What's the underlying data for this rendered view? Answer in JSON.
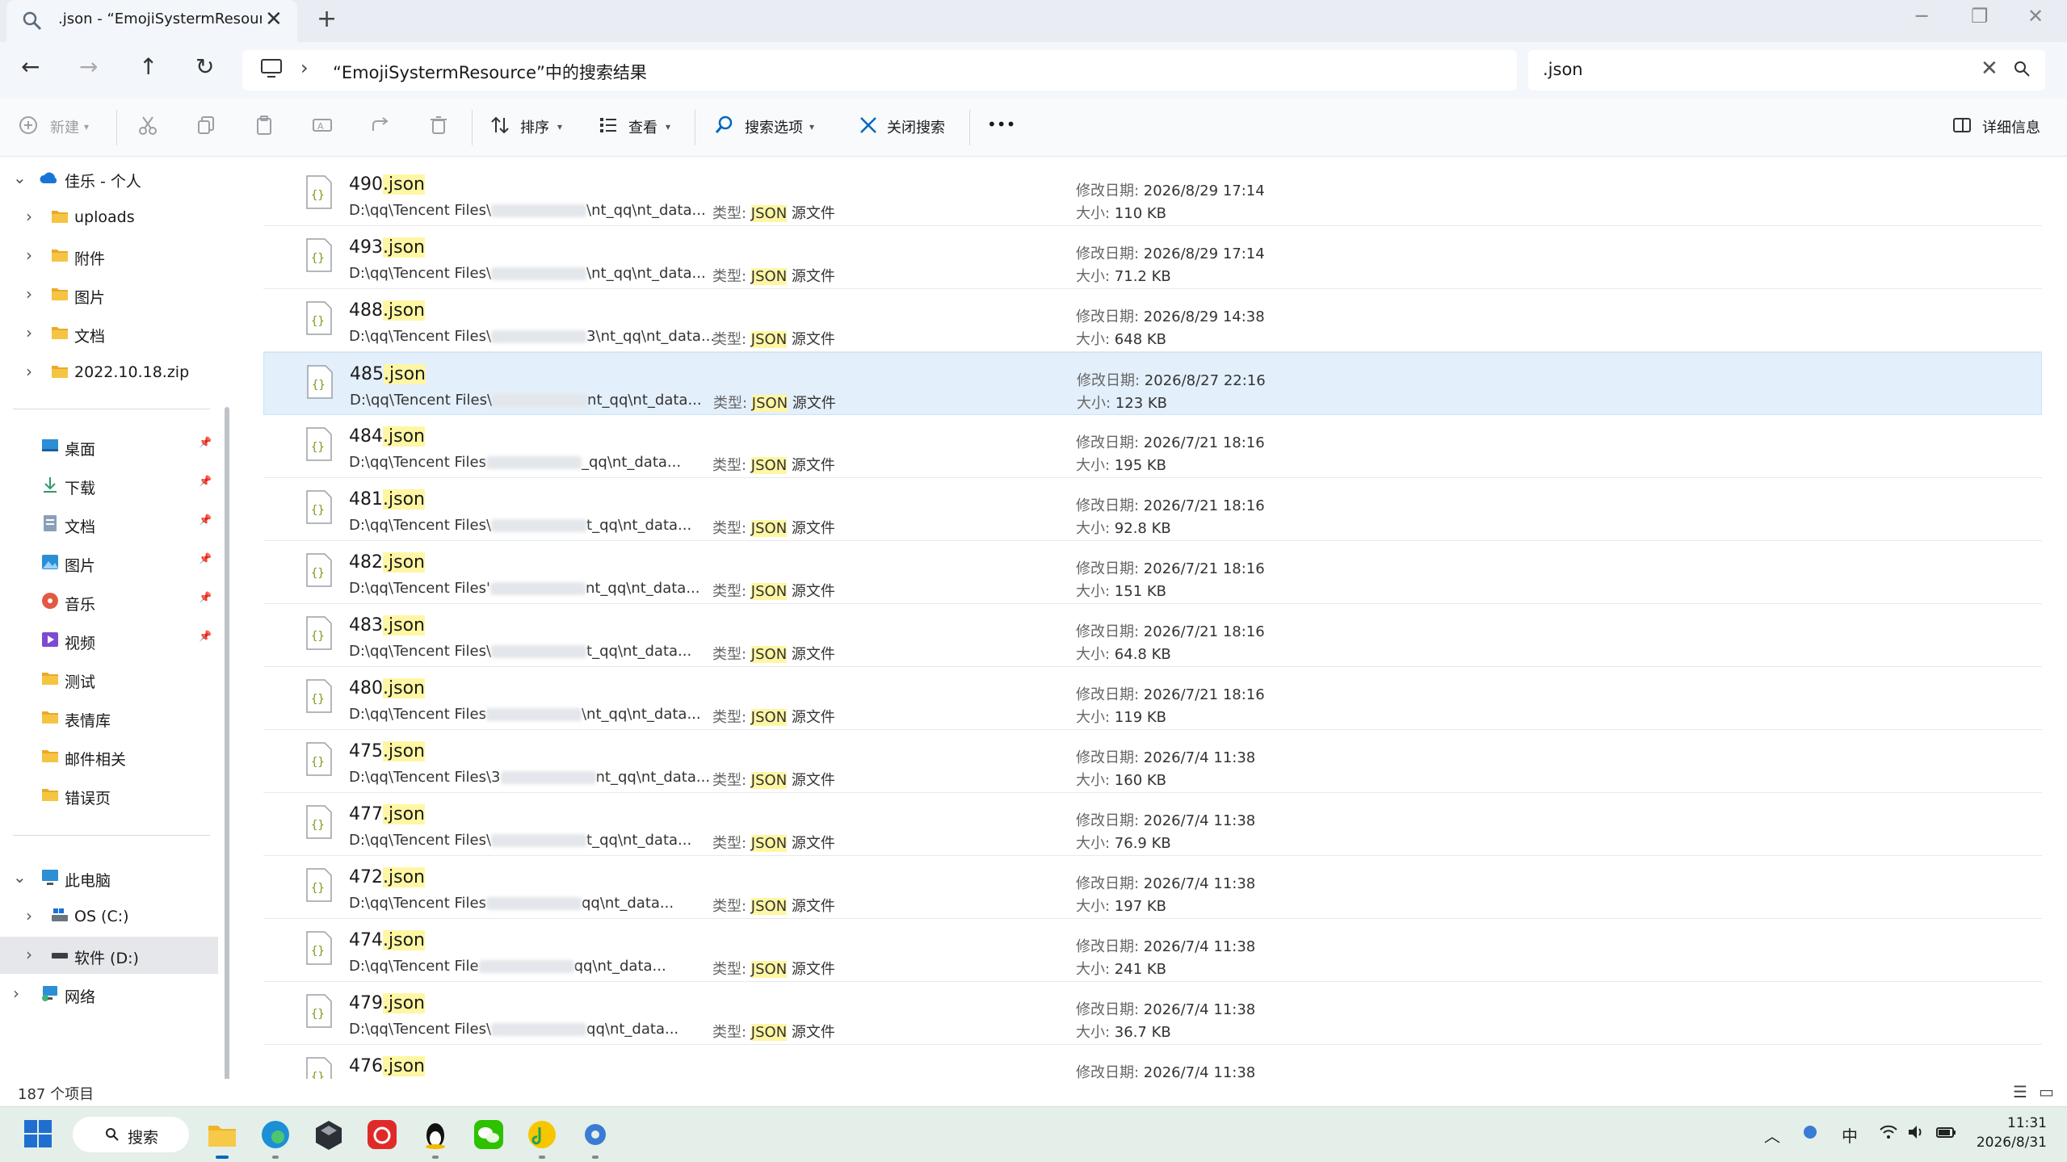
{
  "window": {
    "tab_title": ".json - “EmojiSystermResource",
    "tab_close": "✕",
    "new_tab": "+",
    "minimize": "─",
    "restore": "❐",
    "close": "✕"
  },
  "nav": {
    "back": "←",
    "forward": "→",
    "up": "↑",
    "refresh": "↻",
    "chevron": "›",
    "address": "“EmojiSystermResource”中的搜索结果",
    "search_value": ".json",
    "search_clear": "✕"
  },
  "toolbar": {
    "new": "新建",
    "sort": "排序",
    "view": "查看",
    "search_options": "搜索选项",
    "close_search": "关闭搜索",
    "more": "•••",
    "details": "详细信息"
  },
  "sidebar": {
    "onedrive": "佳乐 - 个人",
    "od_items": [
      "uploads",
      "附件",
      "图片",
      "文档",
      "2022.10.18.zip"
    ],
    "quick": [
      {
        "label": "桌面",
        "icon": "desktop-icon",
        "pinned": true
      },
      {
        "label": "下载",
        "icon": "download-icon",
        "pinned": true
      },
      {
        "label": "文档",
        "icon": "document-icon",
        "pinned": true
      },
      {
        "label": "图片",
        "icon": "pictures-icon",
        "pinned": true
      },
      {
        "label": "音乐",
        "icon": "music-icon",
        "pinned": true
      },
      {
        "label": "视频",
        "icon": "video-icon",
        "pinned": true
      },
      {
        "label": "测试",
        "icon": "folder-icon",
        "pinned": false
      },
      {
        "label": "表情库",
        "icon": "folder-icon",
        "pinned": false
      },
      {
        "label": "邮件相关",
        "icon": "folder-icon",
        "pinned": false
      },
      {
        "label": "错误页",
        "icon": "folder-icon",
        "pinned": false
      }
    ],
    "this_pc": "此电脑",
    "drive_c": "OS (C:)",
    "drive_d": "软件 (D:)",
    "network": "网络"
  },
  "labels": {
    "type_prefix": "类型: ",
    "type_hl": "JSON",
    "type_suffix": " 源文件",
    "modified": "修改日期: ",
    "size": "大小: ",
    "ext": ".json"
  },
  "files": [
    {
      "name": "490",
      "path_a": "D:\\qq\\Tencent Files\\",
      "path_b": "\\nt_qq\\nt_data...",
      "modified": "2026/8/29 17:14",
      "size": "110 KB"
    },
    {
      "name": "493",
      "path_a": "D:\\qq\\Tencent Files\\",
      "path_b": "\\nt_qq\\nt_data...",
      "modified": "2026/8/29 17:14",
      "size": "71.2 KB"
    },
    {
      "name": "488",
      "path_a": "D:\\qq\\Tencent Files\\",
      "path_b": "3\\nt_qq\\nt_data...",
      "modified": "2026/8/29 14:38",
      "size": "648 KB"
    },
    {
      "name": "485",
      "path_a": "D:\\qq\\Tencent Files\\",
      "path_b": "nt_qq\\nt_data...",
      "modified": "2026/8/27 22:16",
      "size": "123 KB"
    },
    {
      "name": "484",
      "path_a": "D:\\qq\\Tencent Files",
      "path_b": "_qq\\nt_data...",
      "modified": "2026/7/21 18:16",
      "size": "195 KB"
    },
    {
      "name": "481",
      "path_a": "D:\\qq\\Tencent Files\\",
      "path_b": "t_qq\\nt_data...",
      "modified": "2026/7/21 18:16",
      "size": "92.8 KB"
    },
    {
      "name": "482",
      "path_a": "D:\\qq\\Tencent Files'",
      "path_b": "nt_qq\\nt_data...",
      "modified": "2026/7/21 18:16",
      "size": "151 KB"
    },
    {
      "name": "483",
      "path_a": "D:\\qq\\Tencent Files\\",
      "path_b": "t_qq\\nt_data...",
      "modified": "2026/7/21 18:16",
      "size": "64.8 KB"
    },
    {
      "name": "480",
      "path_a": "D:\\qq\\Tencent Files",
      "path_b": "\\nt_qq\\nt_data...",
      "modified": "2026/7/21 18:16",
      "size": "119 KB"
    },
    {
      "name": "475",
      "path_a": "D:\\qq\\Tencent Files\\3",
      "path_b": "nt_qq\\nt_data...",
      "modified": "2026/7/4 11:38",
      "size": "160 KB"
    },
    {
      "name": "477",
      "path_a": "D:\\qq\\Tencent Files\\",
      "path_b": "t_qq\\nt_data...",
      "modified": "2026/7/4 11:38",
      "size": "76.9 KB"
    },
    {
      "name": "472",
      "path_a": "D:\\qq\\Tencent Files",
      "path_b": "qq\\nt_data...",
      "modified": "2026/7/4 11:38",
      "size": "197 KB"
    },
    {
      "name": "474",
      "path_a": "D:\\qq\\Tencent File",
      "path_b": "qq\\nt_data...",
      "modified": "2026/7/4 11:38",
      "size": "241 KB"
    },
    {
      "name": "479",
      "path_a": "D:\\qq\\Tencent Files\\",
      "path_b": "qq\\nt_data...",
      "modified": "2026/7/4 11:38",
      "size": "36.7 KB"
    },
    {
      "name": "476",
      "path_a": "",
      "path_b": "",
      "modified": "2026/7/4 11:38",
      "size": ""
    }
  ],
  "status": {
    "count": "187 个项目",
    "view_details": "☰",
    "view_tiles": "▭"
  },
  "taskbar": {
    "search": "搜索",
    "ime": "中",
    "time": "11:31",
    "date": "2026/8/31",
    "tray_up": "︿"
  },
  "colors": {
    "accent": "#0067c0",
    "highlight": "#fff6a3",
    "selection": "#e3effb",
    "taskbar": "#e4efe9"
  }
}
